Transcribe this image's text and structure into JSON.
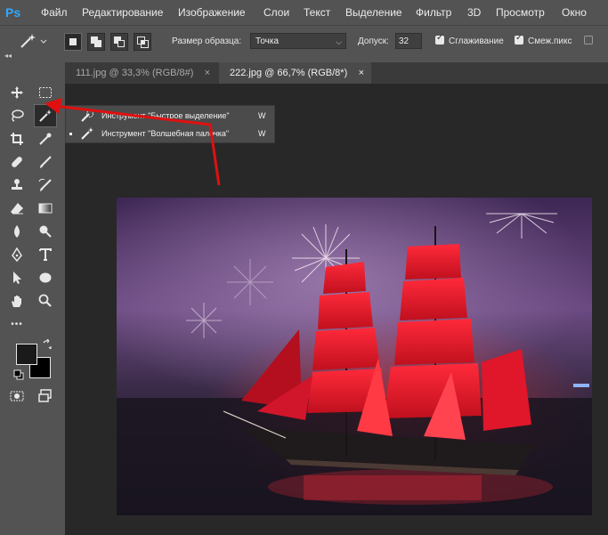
{
  "app": {
    "logo": "Ps"
  },
  "menu": [
    "Файл",
    "Редактирование",
    "Изображение",
    "Слои",
    "Текст",
    "Выделение",
    "Фильтр",
    "3D",
    "Просмотр",
    "Окно"
  ],
  "options": {
    "sample_size_label": "Размер образца:",
    "sample_size_value": "Точка",
    "tolerance_label": "Допуск:",
    "tolerance_value": "32",
    "antialias_label": "Сглаживание",
    "contiguous_label": "Смеж.пикс"
  },
  "tabs": [
    {
      "label": "111.jpg @ 33,3% (RGB/8#)",
      "close": "×"
    },
    {
      "label": "222.jpg @ 66,7% (RGB/8*)",
      "close": "×"
    }
  ],
  "flyout": [
    {
      "label": "Инструмент \"Быстрое выделение\"",
      "key": "W"
    },
    {
      "label": "Инструмент \"Волшебная палочка\"",
      "key": "W"
    }
  ],
  "collapse_glyph": "◂◂",
  "toolbar_more": "•••",
  "colors": {
    "accent": "#31a8ff",
    "annotation": "#e01010",
    "foreground": "#1a1a1a",
    "background": "#000000"
  }
}
